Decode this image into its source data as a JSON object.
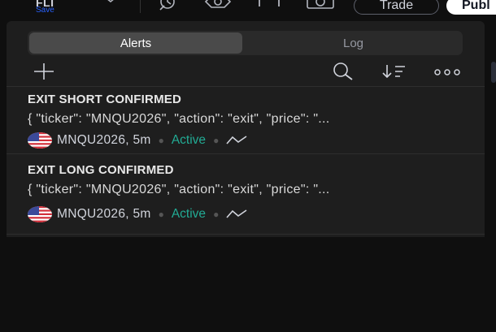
{
  "app": {
    "brand": "FLI",
    "save_label": "Save",
    "trade_label": "Trade",
    "publish_label": "Publ"
  },
  "tabs": [
    {
      "label": "Alerts",
      "selected": true
    },
    {
      "label": "Log",
      "selected": false
    }
  ],
  "actions": {
    "add": "add-icon",
    "search": "search-icon",
    "sort": "sort-icon",
    "more": "more-icon"
  },
  "alerts": [
    {
      "title": "EXIT SHORT CONFIRMED",
      "message": "{ \"ticker\": \"MNQU2026\", \"action\": \"exit\", \"price\": \"...",
      "symbol": "MNQU2026, 5m",
      "status": "Active",
      "icon": "spark-icon"
    },
    {
      "title": "EXIT LONG CONFIRMED",
      "message": "{ \"ticker\": \"MNQU2026\", \"action\": \"exit\", \"price\": \"...",
      "symbol": "MNQU2026, 5m",
      "status": "Active",
      "icon": "spark-icon"
    }
  ],
  "colors": {
    "active": "#22ab94",
    "save": "#2962ff",
    "panel": "#1e1e1e",
    "background": "#0f0f0f"
  }
}
